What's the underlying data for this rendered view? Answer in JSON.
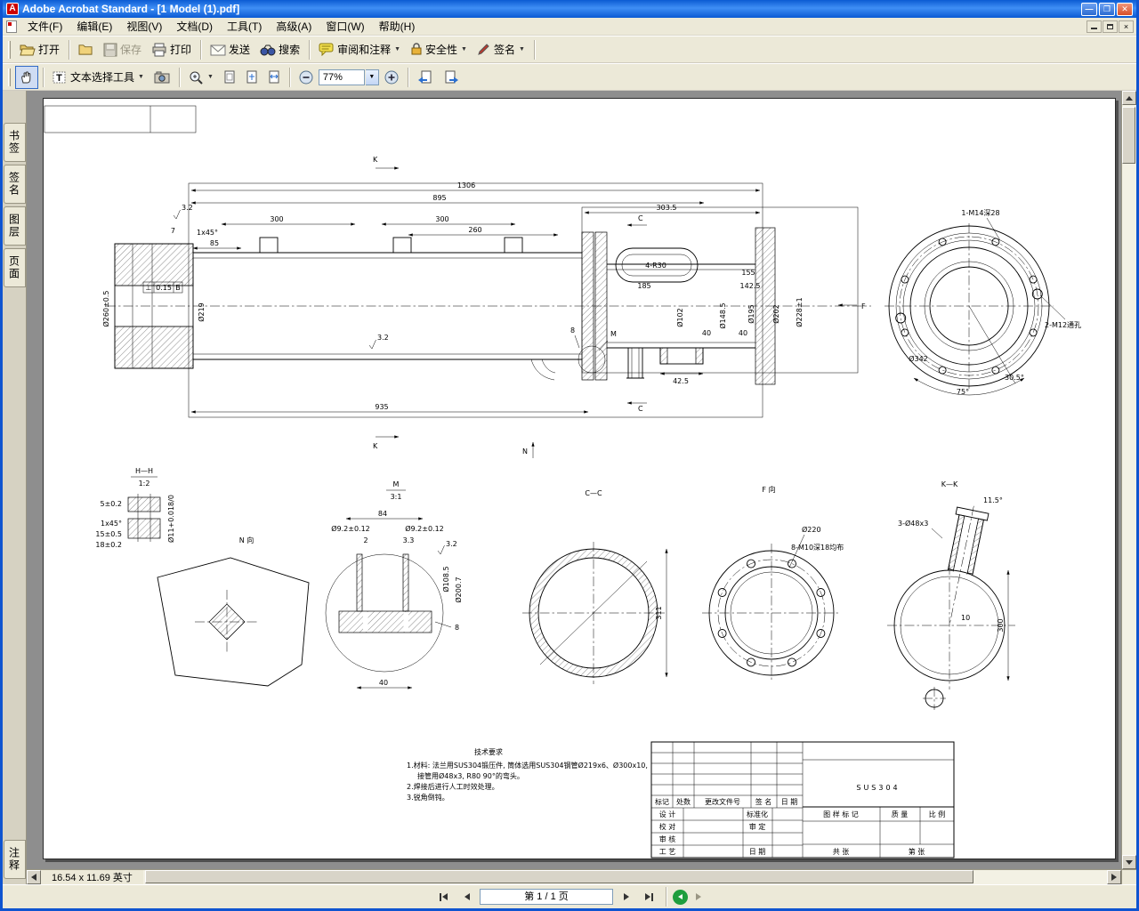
{
  "window": {
    "title": "Adobe Acrobat Standard - [1 Model (1).pdf]"
  },
  "menu": {
    "items": [
      "文件(F)",
      "编辑(E)",
      "视图(V)",
      "文档(D)",
      "工具(T)",
      "高级(A)",
      "窗口(W)",
      "帮助(H)"
    ]
  },
  "toolbar": {
    "open": "打开",
    "save": "保存",
    "print": "打印",
    "send": "发送",
    "search": "搜索",
    "review": "审阅和注释",
    "security": "安全性",
    "sign": "签名",
    "text_tool": "文本选择工具",
    "text_tool_glyph": "T",
    "zoom_value": "77%"
  },
  "sidebar": {
    "tabs": [
      "书签",
      "签名",
      "图层",
      "页面"
    ],
    "bottom_tab": "注释"
  },
  "statusbar": {
    "page_size": "16.54 x 11.69 英寸"
  },
  "pagenav": {
    "label": "第 1 / 1 页"
  },
  "drawing": {
    "main": {
      "k": "K",
      "c": "C",
      "f": "F",
      "n": "N",
      "m": "M",
      "dim_1306": "1306",
      "dim_895": "895",
      "dim_303_5": "303.5",
      "dim_300_1": "300",
      "dim_300_2": "300",
      "dim_260": "260",
      "dim_185": "185",
      "dim_155": "155",
      "dim_142_5": "142.5",
      "dim_4r30": "4-R30",
      "dim_935": "935",
      "dim_85": "85",
      "dim_7": "7",
      "chamfer": "1x45°",
      "finish": "3.2",
      "fcf_sym": "⊥",
      "fcf_tol": "0.15",
      "fcf_datum": "B",
      "dim_d260": "Ø260±0.5",
      "dim_d219": "Ø219",
      "dim_40_1": "40",
      "dim_40_2": "40",
      "dim_8": "8",
      "dim_42_5": "42.5",
      "dim_d102": "Ø102",
      "dim_d148": "Ø148.5",
      "dim_d195": "Ø195",
      "dim_d202": "Ø202",
      "dim_d228": "Ø228±1"
    },
    "flange_view": {
      "m12": "2-M12通孔",
      "d342": "Ø342",
      "a75": "75°",
      "a305": "30.5°",
      "m14": "1-M14深28"
    },
    "view_hh": {
      "title": "H—H",
      "scale": "1:2",
      "dim_5": "5±0.2",
      "chamfer": "1x45°",
      "dim_15": "15±0.5",
      "dim_18": "18±0.2",
      "bore": "Ø11+0.018/0"
    },
    "view_n": {
      "title": "N 向"
    },
    "view_m": {
      "title": "M",
      "scale": "3:1",
      "dim_84": "84",
      "d92_1": "Ø9.2±0.12",
      "d92_2": "Ø9.2±0.12",
      "dim_2": "2",
      "dim_3_3": "3.3",
      "d108": "Ø108.5",
      "d200": "Ø200.7",
      "finish": "3.2",
      "dim_40": "40",
      "dim_8": "8"
    },
    "view_cc": {
      "title": "C—C",
      "dim_311": "311"
    },
    "view_f": {
      "title": "F 向",
      "d220": "Ø220",
      "m10": "8-M10深18均布"
    },
    "view_kk": {
      "title": "K—K",
      "a115": "11.5°",
      "d48": "3-Ø48x3",
      "dim_300": "300",
      "dim_10": "10"
    },
    "tech": {
      "title": "技术要求",
      "line1": "1.材料: 法兰用SUS304锻压件, 筒体选用SUS304钢管Ø219x6、Ø300x10,",
      "line2": "接管用Ø48x3, R80 90°的弯头。",
      "line3": "2.焊接后进行人工时效处理。",
      "line4": "3.锐角倒钝。"
    },
    "titleblock": {
      "material": "SUS304",
      "mark": "标记",
      "count": "处数",
      "doc_no": "更改文件号",
      "sign": "签 名",
      "date_h": "日 期",
      "design": "设 计",
      "standardize": "标准化",
      "proof": "校 对",
      "ratify": "审 定",
      "review": "审 核",
      "craft": "工 艺",
      "date": "日 期",
      "drawing_mark": "图 样 标 记",
      "weight": "质 量",
      "scale": "比 例",
      "total": "共 张",
      "sheet": "第 张"
    }
  }
}
